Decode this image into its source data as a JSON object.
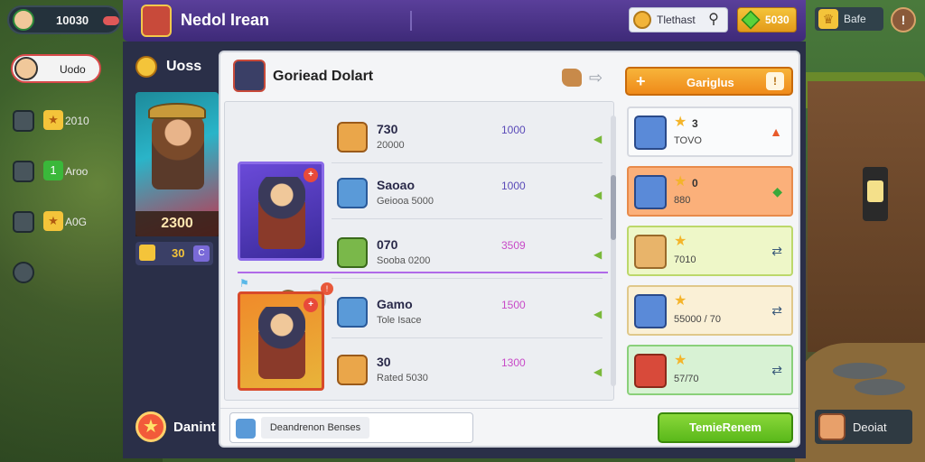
{
  "top_left": {
    "value": "10030"
  },
  "header": {
    "title": "Nedol Irean"
  },
  "search": {
    "label": "Tlethast"
  },
  "gems": {
    "value": "5030"
  },
  "top_right": {
    "value": "Bafe"
  },
  "side_nav": {
    "profile_label": "Uodo",
    "items": [
      {
        "label": "2010"
      },
      {
        "label": "Aroo"
      },
      {
        "label": "A0G"
      }
    ]
  },
  "hero": {
    "title": "Uoss",
    "power": "2300",
    "level": "30",
    "level_badge": "C",
    "bottom_label": "Danint"
  },
  "dialog": {
    "title": "Goriead Dolart",
    "rows": [
      {
        "name": "730",
        "sub": "20000",
        "cost": "1000"
      },
      {
        "name": "Saoao",
        "sub": "Geiooa 5000",
        "cost": "1000"
      },
      {
        "name": "070",
        "sub": "Sooba 0200",
        "cost": "3509"
      },
      {
        "name": "Gamo",
        "sub": "Tole Isace",
        "cost": "1500"
      },
      {
        "name": "30",
        "sub": "Rated 5030",
        "cost": "1300"
      }
    ],
    "shop_button": "Gariglus",
    "rewards": [
      {
        "count": "3",
        "sub": "TOVO"
      },
      {
        "count": "0",
        "sub": "880"
      },
      {
        "count": "",
        "sub": "7010"
      },
      {
        "count": "",
        "sub": "55000 / 70"
      },
      {
        "count": "",
        "sub": "57/70"
      }
    ],
    "search_value": "Deandrenon Benses",
    "confirm_label": "TemieRenem"
  },
  "bottom_right": {
    "label": "Deoiat"
  },
  "colors": {
    "accent": "#5a3f9a",
    "confirm": "#5ab81a",
    "shop": "#ef8a1a"
  }
}
